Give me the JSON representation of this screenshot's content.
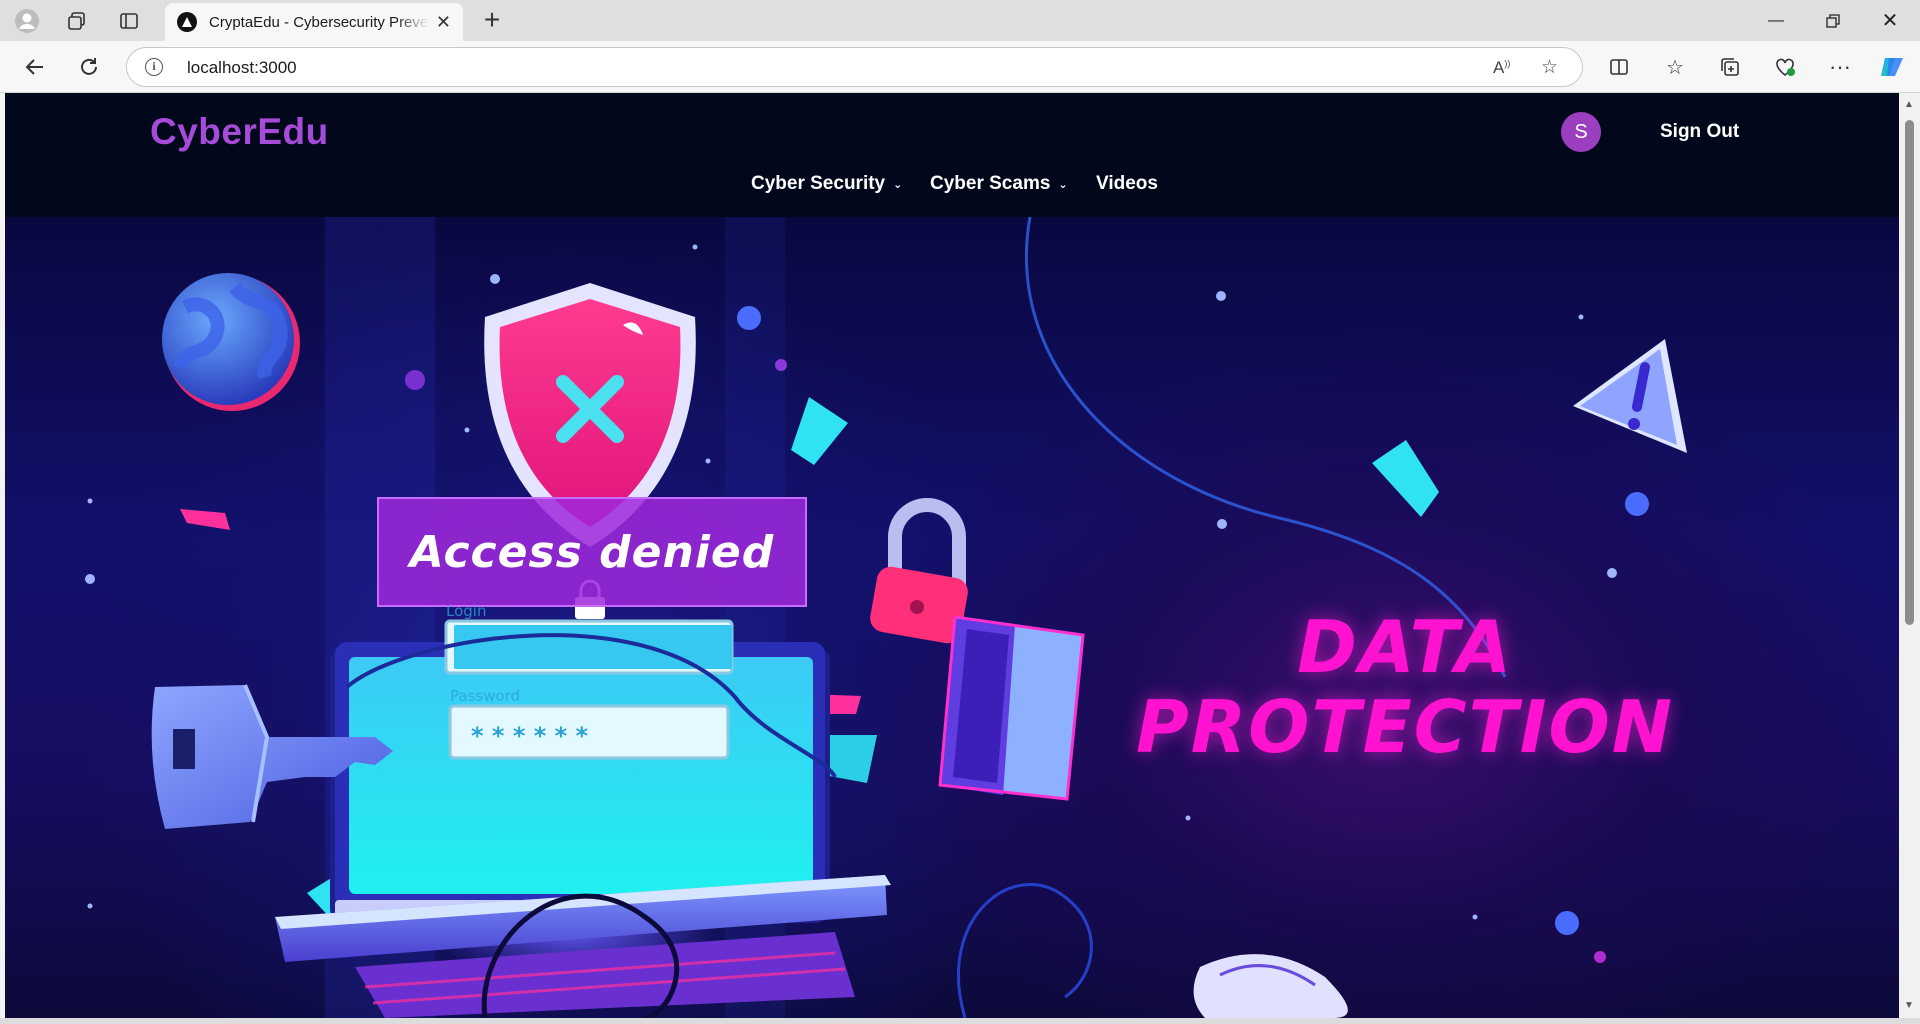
{
  "browser": {
    "tab_title": "CryptaEdu - Cybersecurity Prevention",
    "url": "localhost:3000",
    "icons": [
      "profile-icon",
      "workspaces-icon",
      "tab-actions-icon",
      "back-icon",
      "refresh-icon",
      "info-icon",
      "read-aloud-icon",
      "favorite-star-icon",
      "split-screen-icon",
      "favorites-icon",
      "collections-icon",
      "browser-essentials-icon",
      "more-icon",
      "copilot-icon",
      "minimize-icon",
      "restore-icon",
      "close-icon"
    ]
  },
  "site": {
    "brand": "CyberEdu",
    "avatar_initial": "S",
    "sign_out_label": "Sign Out",
    "nav": [
      {
        "label": "Cyber Security",
        "has_dropdown": true
      },
      {
        "label": "Cyber Scams",
        "has_dropdown": true
      },
      {
        "label": "Videos",
        "has_dropdown": false
      }
    ]
  },
  "hero": {
    "banner_text": "Access denied",
    "login_label": "Login",
    "password_label": "Password",
    "password_mask": "* * * * * *",
    "headline_line1": "DATA",
    "headline_line2": "PROTECTION",
    "colors": {
      "accent": "#ff13d0",
      "brand": "#a64ad8",
      "background": "#02071a"
    }
  }
}
